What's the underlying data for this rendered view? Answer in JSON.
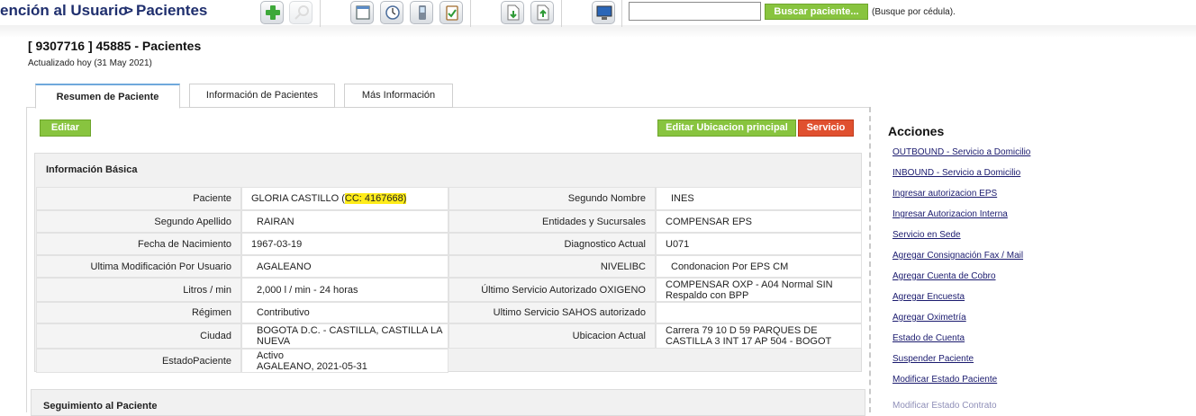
{
  "header": {
    "breadcrumb_section": "ención al Usuario",
    "breadcrumb_sep": ">",
    "breadcrumb_current": "Pacientes",
    "search_button": "Buscar paciente...",
    "search_hint": "(Busque por cédula).",
    "search_value": ""
  },
  "patient": {
    "title": "[ 9307716 ] 45885 - Pacientes",
    "updated": "Actualizado hoy (31 May 2021)"
  },
  "tabs": [
    "Resumen de Paciente",
    "Información de Pacientes",
    "Más Información"
  ],
  "toolbar": {
    "edit": "Editar",
    "edit_location": "Editar Ubicacion principal",
    "service": "Servicio"
  },
  "basic_info": {
    "header": "Información Básica",
    "left": [
      {
        "label": "Paciente",
        "value": "GLORIA CASTILLO (",
        "badge": "CC: 4167668)"
      },
      {
        "label": "Segundo Apellido",
        "value": "RAIRAN"
      },
      {
        "label": "Fecha de Nacimiento",
        "value": "1967-03-19"
      },
      {
        "label": "Ultima Modificación Por Usuario",
        "value": "AGALEANO"
      },
      {
        "label": "Litros / min",
        "value": "2,000 l / min - 24 horas"
      },
      {
        "label": "Régimen",
        "value": "Contributivo"
      },
      {
        "label": "Ciudad",
        "value": "BOGOTA D.C. - CASTILLA, CASTILLA LA NUEVA"
      },
      {
        "label": "EstadoPaciente",
        "value": "Activo",
        "value2": "AGALEANO, 2021-05-31"
      }
    ],
    "right": [
      {
        "label": "Segundo Nombre",
        "value": "INES"
      },
      {
        "label": "Entidades y Sucursales",
        "value": "COMPENSAR EPS"
      },
      {
        "label": "Diagnostico Actual",
        "value": "U071"
      },
      {
        "label": "NIVELIBC",
        "value": "Condonacion Por EPS CM"
      },
      {
        "label": "Último Servicio Autorizado OXIGENO",
        "value": "COMPENSAR OXP - A04 Normal SIN Respaldo con BPP"
      },
      {
        "label": "Ultimo Servicio SAHOS autorizado",
        "value": ""
      },
      {
        "label": "Ubicacion Actual",
        "value": "Carrera 79 10 D 59 PARQUES DE CASTILLA 3 INT 17 AP 504 - BOGOT"
      }
    ]
  },
  "followup": {
    "title": "Seguimiento al Paciente"
  },
  "actions": {
    "title": "Acciones",
    "items": [
      "OUTBOUND - Servicio a Domicilio",
      "INBOUND - Servicio a Domicilio",
      "Ingresar autorizacion EPS",
      "Ingresar Autorizacion Interna",
      "Servicio en Sede",
      "Agregar Consignación Fax / Mail",
      "Agregar Cuenta de Cobro",
      "Agregar Encuesta",
      "Agregar Oximetría",
      "Estado de Cuenta",
      "Suspender Paciente",
      "Modificar Estado Paciente",
      "Modificar Estado Contrato"
    ]
  },
  "colors": {
    "accent_green": "#88c43f",
    "accent_red": "#e0502f",
    "nav_blue": "#1f2f6e",
    "highlight": "#ffec1a"
  }
}
